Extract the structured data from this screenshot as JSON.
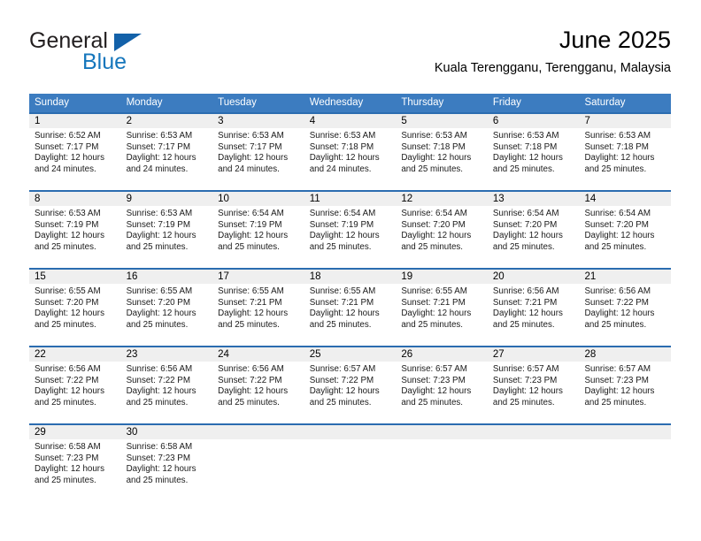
{
  "brand": {
    "name_top": "General",
    "name_bottom": "Blue",
    "color_dark": "#231f20",
    "color_blue": "#1576bc",
    "triangle_icon": "triangle-icon"
  },
  "header": {
    "title": "June 2025",
    "location": "Kuala Terengganu, Terengganu, Malaysia"
  },
  "theme": {
    "header_bg": "#3c7cc0",
    "header_text": "#ffffff",
    "week_divider": "#2b6cb0",
    "daynum_band": "#efefef",
    "cell_bg": "#ffffff"
  },
  "weekdays": [
    "Sunday",
    "Monday",
    "Tuesday",
    "Wednesday",
    "Thursday",
    "Friday",
    "Saturday"
  ],
  "weeks": [
    {
      "days": [
        {
          "num": "1",
          "sunrise": "Sunrise: 6:52 AM",
          "sunset": "Sunset: 7:17 PM",
          "daylight1": "Daylight: 12 hours",
          "daylight2": "and 24 minutes."
        },
        {
          "num": "2",
          "sunrise": "Sunrise: 6:53 AM",
          "sunset": "Sunset: 7:17 PM",
          "daylight1": "Daylight: 12 hours",
          "daylight2": "and 24 minutes."
        },
        {
          "num": "3",
          "sunrise": "Sunrise: 6:53 AM",
          "sunset": "Sunset: 7:17 PM",
          "daylight1": "Daylight: 12 hours",
          "daylight2": "and 24 minutes."
        },
        {
          "num": "4",
          "sunrise": "Sunrise: 6:53 AM",
          "sunset": "Sunset: 7:18 PM",
          "daylight1": "Daylight: 12 hours",
          "daylight2": "and 24 minutes."
        },
        {
          "num": "5",
          "sunrise": "Sunrise: 6:53 AM",
          "sunset": "Sunset: 7:18 PM",
          "daylight1": "Daylight: 12 hours",
          "daylight2": "and 25 minutes."
        },
        {
          "num": "6",
          "sunrise": "Sunrise: 6:53 AM",
          "sunset": "Sunset: 7:18 PM",
          "daylight1": "Daylight: 12 hours",
          "daylight2": "and 25 minutes."
        },
        {
          "num": "7",
          "sunrise": "Sunrise: 6:53 AM",
          "sunset": "Sunset: 7:18 PM",
          "daylight1": "Daylight: 12 hours",
          "daylight2": "and 25 minutes."
        }
      ]
    },
    {
      "days": [
        {
          "num": "8",
          "sunrise": "Sunrise: 6:53 AM",
          "sunset": "Sunset: 7:19 PM",
          "daylight1": "Daylight: 12 hours",
          "daylight2": "and 25 minutes."
        },
        {
          "num": "9",
          "sunrise": "Sunrise: 6:53 AM",
          "sunset": "Sunset: 7:19 PM",
          "daylight1": "Daylight: 12 hours",
          "daylight2": "and 25 minutes."
        },
        {
          "num": "10",
          "sunrise": "Sunrise: 6:54 AM",
          "sunset": "Sunset: 7:19 PM",
          "daylight1": "Daylight: 12 hours",
          "daylight2": "and 25 minutes."
        },
        {
          "num": "11",
          "sunrise": "Sunrise: 6:54 AM",
          "sunset": "Sunset: 7:19 PM",
          "daylight1": "Daylight: 12 hours",
          "daylight2": "and 25 minutes."
        },
        {
          "num": "12",
          "sunrise": "Sunrise: 6:54 AM",
          "sunset": "Sunset: 7:20 PM",
          "daylight1": "Daylight: 12 hours",
          "daylight2": "and 25 minutes."
        },
        {
          "num": "13",
          "sunrise": "Sunrise: 6:54 AM",
          "sunset": "Sunset: 7:20 PM",
          "daylight1": "Daylight: 12 hours",
          "daylight2": "and 25 minutes."
        },
        {
          "num": "14",
          "sunrise": "Sunrise: 6:54 AM",
          "sunset": "Sunset: 7:20 PM",
          "daylight1": "Daylight: 12 hours",
          "daylight2": "and 25 minutes."
        }
      ]
    },
    {
      "days": [
        {
          "num": "15",
          "sunrise": "Sunrise: 6:55 AM",
          "sunset": "Sunset: 7:20 PM",
          "daylight1": "Daylight: 12 hours",
          "daylight2": "and 25 minutes."
        },
        {
          "num": "16",
          "sunrise": "Sunrise: 6:55 AM",
          "sunset": "Sunset: 7:20 PM",
          "daylight1": "Daylight: 12 hours",
          "daylight2": "and 25 minutes."
        },
        {
          "num": "17",
          "sunrise": "Sunrise: 6:55 AM",
          "sunset": "Sunset: 7:21 PM",
          "daylight1": "Daylight: 12 hours",
          "daylight2": "and 25 minutes."
        },
        {
          "num": "18",
          "sunrise": "Sunrise: 6:55 AM",
          "sunset": "Sunset: 7:21 PM",
          "daylight1": "Daylight: 12 hours",
          "daylight2": "and 25 minutes."
        },
        {
          "num": "19",
          "sunrise": "Sunrise: 6:55 AM",
          "sunset": "Sunset: 7:21 PM",
          "daylight1": "Daylight: 12 hours",
          "daylight2": "and 25 minutes."
        },
        {
          "num": "20",
          "sunrise": "Sunrise: 6:56 AM",
          "sunset": "Sunset: 7:21 PM",
          "daylight1": "Daylight: 12 hours",
          "daylight2": "and 25 minutes."
        },
        {
          "num": "21",
          "sunrise": "Sunrise: 6:56 AM",
          "sunset": "Sunset: 7:22 PM",
          "daylight1": "Daylight: 12 hours",
          "daylight2": "and 25 minutes."
        }
      ]
    },
    {
      "days": [
        {
          "num": "22",
          "sunrise": "Sunrise: 6:56 AM",
          "sunset": "Sunset: 7:22 PM",
          "daylight1": "Daylight: 12 hours",
          "daylight2": "and 25 minutes."
        },
        {
          "num": "23",
          "sunrise": "Sunrise: 6:56 AM",
          "sunset": "Sunset: 7:22 PM",
          "daylight1": "Daylight: 12 hours",
          "daylight2": "and 25 minutes."
        },
        {
          "num": "24",
          "sunrise": "Sunrise: 6:56 AM",
          "sunset": "Sunset: 7:22 PM",
          "daylight1": "Daylight: 12 hours",
          "daylight2": "and 25 minutes."
        },
        {
          "num": "25",
          "sunrise": "Sunrise: 6:57 AM",
          "sunset": "Sunset: 7:22 PM",
          "daylight1": "Daylight: 12 hours",
          "daylight2": "and 25 minutes."
        },
        {
          "num": "26",
          "sunrise": "Sunrise: 6:57 AM",
          "sunset": "Sunset: 7:23 PM",
          "daylight1": "Daylight: 12 hours",
          "daylight2": "and 25 minutes."
        },
        {
          "num": "27",
          "sunrise": "Sunrise: 6:57 AM",
          "sunset": "Sunset: 7:23 PM",
          "daylight1": "Daylight: 12 hours",
          "daylight2": "and 25 minutes."
        },
        {
          "num": "28",
          "sunrise": "Sunrise: 6:57 AM",
          "sunset": "Sunset: 7:23 PM",
          "daylight1": "Daylight: 12 hours",
          "daylight2": "and 25 minutes."
        }
      ]
    },
    {
      "days": [
        {
          "num": "29",
          "sunrise": "Sunrise: 6:58 AM",
          "sunset": "Sunset: 7:23 PM",
          "daylight1": "Daylight: 12 hours",
          "daylight2": "and 25 minutes."
        },
        {
          "num": "30",
          "sunrise": "Sunrise: 6:58 AM",
          "sunset": "Sunset: 7:23 PM",
          "daylight1": "Daylight: 12 hours",
          "daylight2": "and 25 minutes."
        },
        {
          "num": "",
          "sunrise": "",
          "sunset": "",
          "daylight1": "",
          "daylight2": ""
        },
        {
          "num": "",
          "sunrise": "",
          "sunset": "",
          "daylight1": "",
          "daylight2": ""
        },
        {
          "num": "",
          "sunrise": "",
          "sunset": "",
          "daylight1": "",
          "daylight2": ""
        },
        {
          "num": "",
          "sunrise": "",
          "sunset": "",
          "daylight1": "",
          "daylight2": ""
        },
        {
          "num": "",
          "sunrise": "",
          "sunset": "",
          "daylight1": "",
          "daylight2": ""
        }
      ]
    }
  ]
}
